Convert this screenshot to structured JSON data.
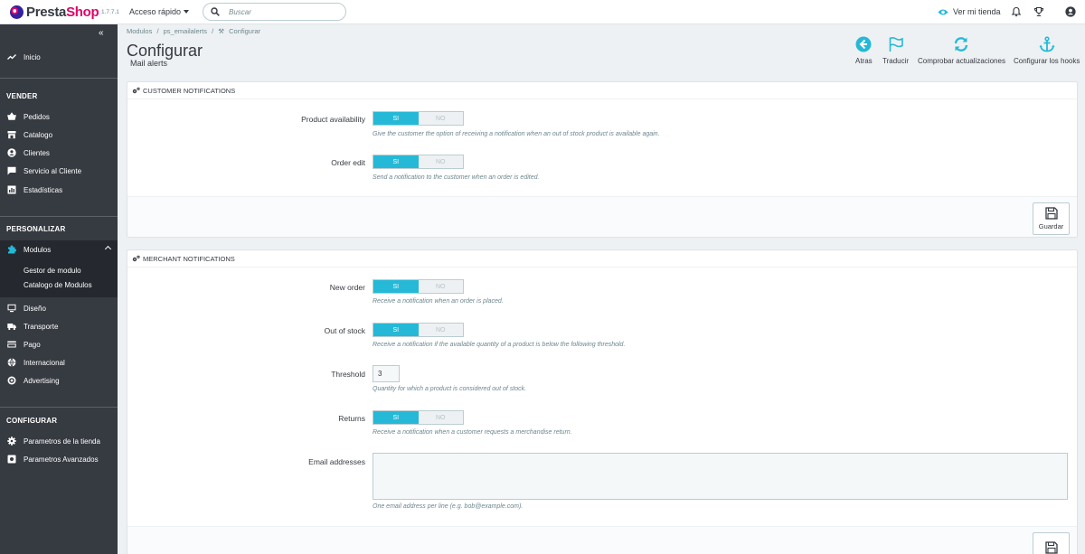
{
  "header": {
    "logo_prefix": "Presta",
    "logo_suffix": "Shop",
    "version": "1.7.7.1",
    "quick_access": "Acceso rápido",
    "search_placeholder": "Buscar",
    "view_shop": "Ver mi tienda"
  },
  "sidebar": {
    "home": "Inicio",
    "sections": {
      "sell": "VENDER",
      "customize": "PERSONALIZAR",
      "configure": "CONFIGURAR"
    },
    "sell_items": [
      "Pedidos",
      "Catalogo",
      "Clientes",
      "Servicio al Cliente",
      "Estadísticas"
    ],
    "modules": "Modulos",
    "module_subitems": [
      "Gestor de modulo",
      "Catalogo de Modulos"
    ],
    "customize_items": [
      "Diseño",
      "Transporte",
      "Pago",
      "Internacional",
      "Advertising"
    ],
    "configure_items": [
      "Parametros de la tienda",
      "Parametros Avanzados"
    ]
  },
  "breadcrumb": [
    "Modulos",
    "/",
    "ps_emailalerts",
    "/",
    "Configurar"
  ],
  "page": {
    "title": "Configurar",
    "subtitle": "Mail alerts"
  },
  "toolbar": {
    "back": "Atras",
    "translate": "Traducir",
    "check_updates": "Comprobar actualizaciones",
    "hooks": "Configurar los hooks"
  },
  "switch_labels": {
    "yes": "SI",
    "no": "NO"
  },
  "customer_panel": {
    "title": "CUSTOMER NOTIFICATIONS",
    "product_availability": {
      "label": "Product availability",
      "help": "Give the customer the option of receiving a notification when an out of stock product is available again."
    },
    "order_edit": {
      "label": "Order edit",
      "help": "Send a notification to the customer when an order is edited."
    },
    "save": "Guardar"
  },
  "merchant_panel": {
    "title": "MERCHANT NOTIFICATIONS",
    "new_order": {
      "label": "New order",
      "help": "Receive a notification when an order is placed."
    },
    "out_of_stock": {
      "label": "Out of stock",
      "help": "Receive a notification if the available quantity of a product is below the following threshold."
    },
    "threshold": {
      "label": "Threshold",
      "value": "3",
      "help": "Quantity for which a product is considered out of stock."
    },
    "returns": {
      "label": "Returns",
      "help": "Receive a notification when a customer requests a merchandise return."
    },
    "emails": {
      "label": "Email addresses",
      "help": "One email address per line (e.g. bob@example.com)."
    }
  },
  "colors": {
    "accent": "#25b9d7",
    "sidebar": "#363a41",
    "brand": "#df0067"
  }
}
